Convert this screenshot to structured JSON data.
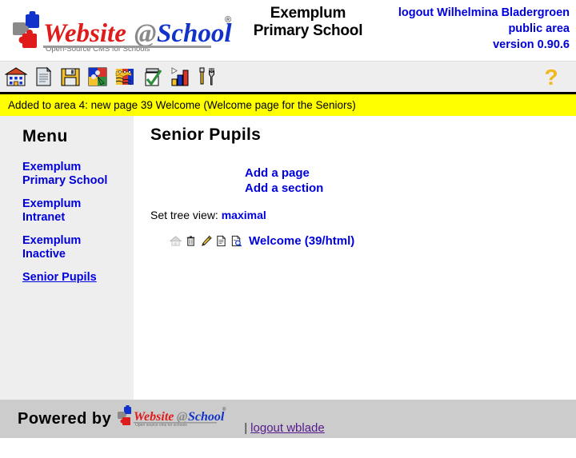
{
  "header": {
    "logo_alt": "Website@School",
    "logo_tagline": "Open-Source CMS for Schools",
    "logo_registered": "®",
    "school_name_line1": "Exemplum",
    "school_name_line2": "Primary School",
    "logout_label": "logout Wilhelmina Bladergroen",
    "area_label": "public area",
    "version_label": "version 0.90.6"
  },
  "toolbar": {
    "icons": [
      {
        "name": "home-icon",
        "title": "Home"
      },
      {
        "name": "page-icon",
        "title": "Pages"
      },
      {
        "name": "save-floppy-icon",
        "title": "Save"
      },
      {
        "name": "modules-puzzle-icon",
        "title": "Modules"
      },
      {
        "name": "users-group-icon",
        "title": "Users"
      },
      {
        "name": "tasks-checklist-icon",
        "title": "Tasks"
      },
      {
        "name": "statistics-chart-icon",
        "title": "Statistics"
      },
      {
        "name": "tools-wrench-icon",
        "title": "Tools"
      }
    ],
    "help_icon": {
      "name": "help-question-icon",
      "glyph": "?",
      "title": "Help"
    }
  },
  "message_bar": {
    "text": "Added to area 4: new page 39 Welcome (Welcome page for the Seniors)",
    "background": "#ffff00"
  },
  "sidebar": {
    "title": "Menu",
    "items": [
      {
        "label": "Exemplum Primary School",
        "current": false
      },
      {
        "label": "Exemplum Intranet",
        "current": false
      },
      {
        "label": "Exemplum Inactive",
        "current": false
      },
      {
        "label": "Senior Pupils",
        "current": true
      }
    ]
  },
  "main": {
    "title": "Senior Pupils",
    "add_page_label": "Add a page",
    "add_section_label": "Add a section",
    "tree_view_prefix": "Set tree view:",
    "tree_view_value": "maximal",
    "tree_rows": [
      {
        "icons": [
          {
            "name": "home-grey-icon",
            "title": "set as homepage (disabled)",
            "interactable": false
          },
          {
            "name": "trash-delete-icon",
            "title": "delete",
            "interactable": true
          },
          {
            "name": "pencil-edit-icon",
            "title": "edit",
            "interactable": true
          },
          {
            "name": "document-properties-icon",
            "title": "properties",
            "interactable": true
          },
          {
            "name": "preview-magnifier-icon",
            "title": "preview",
            "interactable": true
          }
        ],
        "label": "Welcome (39/html)"
      }
    ]
  },
  "footer": {
    "powered_by_label": "Powered by",
    "logo_alt": "Website@School",
    "logo_tagline": "Open source cms for schools",
    "separator": "|",
    "logout_label": "logout wblade"
  },
  "colors": {
    "link_blue": "#0000dd",
    "visited_purple": "#551a8b",
    "toolbar_bg": "#eeeeee",
    "sidebar_bg": "#eeeeee",
    "footer_bg": "#cccccc",
    "message_yellow": "#ffff00",
    "logo_red": "#e01b1b",
    "logo_blue": "#1133cc"
  }
}
